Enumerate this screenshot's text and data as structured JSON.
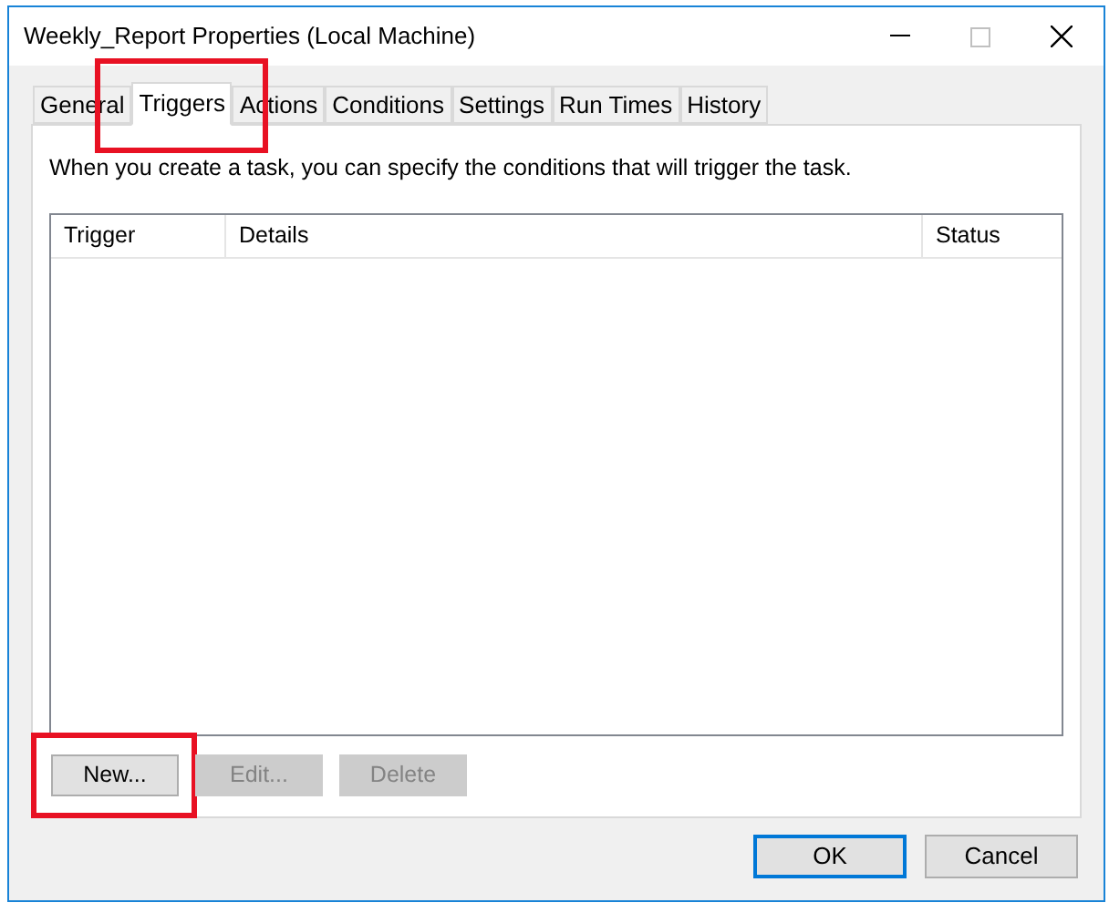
{
  "window": {
    "title": "Weekly_Report Properties (Local Machine)"
  },
  "tabs": [
    {
      "label": "General",
      "selected": false,
      "highlighted": false
    },
    {
      "label": "Triggers",
      "selected": true,
      "highlighted": true
    },
    {
      "label": "Actions",
      "selected": false,
      "highlighted": false
    },
    {
      "label": "Conditions",
      "selected": false,
      "highlighted": false
    },
    {
      "label": "Settings",
      "selected": false,
      "highlighted": false
    },
    {
      "label": "Run Times",
      "selected": false,
      "highlighted": false
    },
    {
      "label": "History",
      "selected": false,
      "highlighted": false
    }
  ],
  "description": "When you create a task, you can specify the conditions that will trigger the task.",
  "table": {
    "columns": [
      "Trigger",
      "Details",
      "Status"
    ]
  },
  "actions": [
    {
      "label": "New...",
      "disabled": false,
      "highlighted": true
    },
    {
      "label": "Edit...",
      "disabled": true,
      "highlighted": false
    },
    {
      "label": "Delete",
      "disabled": true,
      "highlighted": false
    }
  ],
  "buttons": [
    {
      "label": "OK",
      "default": true
    },
    {
      "label": "Cancel",
      "default": false
    }
  ]
}
